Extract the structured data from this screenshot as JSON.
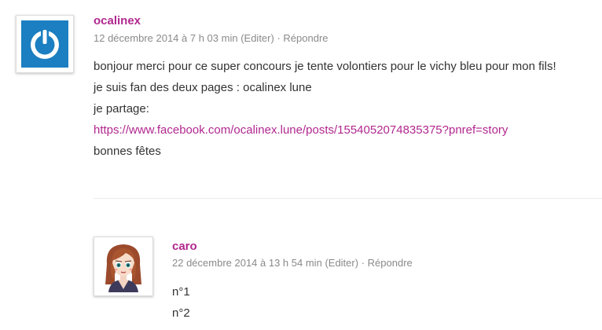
{
  "comments": [
    {
      "author": "ocalinex",
      "date": "12 décembre 2014 à 7 h 03 min",
      "edit_label": "(Editer)",
      "separator": "·",
      "reply_label": "Répondre",
      "avatar_icon": "power-button-icon",
      "lines": [
        "bonjour merci pour ce super concours je tente volontiers pour le vichy bleu pour mon fils!",
        "je suis fan des deux pages : ocalinex lune",
        "je partage:"
      ],
      "link": "https://www.facebook.com/ocalinex.lune/posts/1554052074835375?pnref=story",
      "closing": "bonnes fêtes"
    },
    {
      "author": "caro",
      "date": "22 décembre 2014 à 13 h 54 min",
      "edit_label": "(Editer)",
      "separator": "·",
      "reply_label": "Répondre",
      "avatar_icon": "cartoon-girl-avatar",
      "lines": [
        "n°1",
        "n°2"
      ]
    }
  ],
  "colors": {
    "accent": "#b1288f",
    "meta": "#8a8a8a",
    "text": "#333333",
    "avatar_blue": "#1b7fc1"
  }
}
